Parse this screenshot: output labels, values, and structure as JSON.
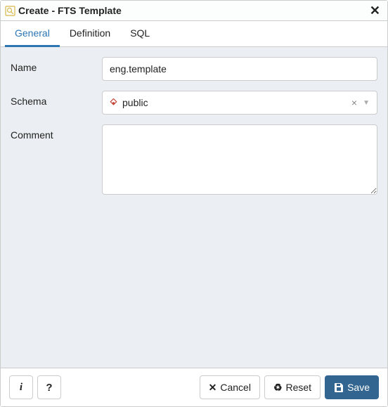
{
  "header": {
    "title": "Create - FTS Template"
  },
  "tabs": [
    {
      "label": "General",
      "active": true
    },
    {
      "label": "Definition",
      "active": false
    },
    {
      "label": "SQL",
      "active": false
    }
  ],
  "form": {
    "name_label": "Name",
    "name_value": "eng.template",
    "schema_label": "Schema",
    "schema_value": "public",
    "comment_label": "Comment",
    "comment_value": ""
  },
  "footer": {
    "info_label": "i",
    "help_label": "?",
    "cancel_label": "Cancel",
    "reset_label": "Reset",
    "save_label": "Save"
  }
}
